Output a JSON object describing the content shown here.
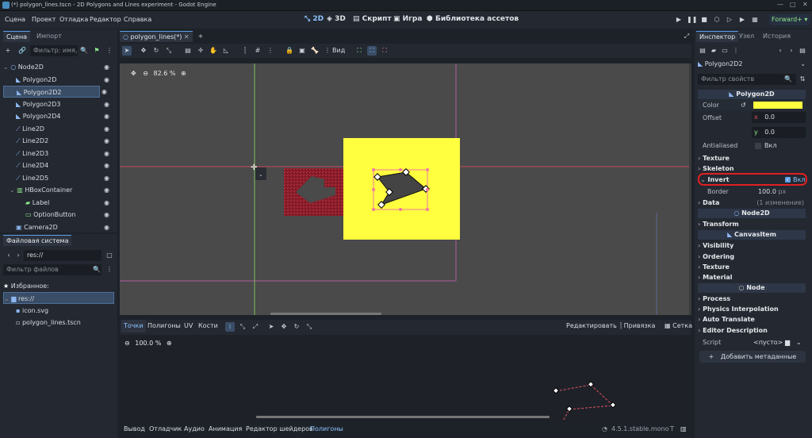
{
  "window": {
    "title": "(*) polygon_lines.tscn - 2D Polygons and Lines experiment - Godot Engine"
  },
  "menu": [
    "Сцена",
    "Проект",
    "Отладка",
    "Редактор",
    "Справка"
  ],
  "workspaces": [
    {
      "label": "2D"
    },
    {
      "label": "3D"
    },
    {
      "label": "Скрипт"
    },
    {
      "label": "Игра"
    },
    {
      "label": "Библиотека ассетов"
    }
  ],
  "renderer": "Forward+",
  "scene_panel": {
    "tabs": [
      "Сцена",
      "Импорт"
    ],
    "filter_placeholder": "Фильтр: имя, т",
    "nodes": [
      {
        "label": "Node2D",
        "icon": "node2d-icon"
      },
      {
        "label": "Polygon2D",
        "icon": "polygon-icon"
      },
      {
        "label": "Polygon2D2",
        "icon": "polygon-icon"
      },
      {
        "label": "Polygon2D3",
        "icon": "polygon-icon"
      },
      {
        "label": "Polygon2D4",
        "icon": "polygon-icon"
      },
      {
        "label": "Line2D",
        "icon": "line-icon"
      },
      {
        "label": "Line2D2",
        "icon": "line-icon"
      },
      {
        "label": "Line2D3",
        "icon": "line-icon"
      },
      {
        "label": "Line2D4",
        "icon": "line-icon"
      },
      {
        "label": "Line2D5",
        "icon": "line-icon"
      },
      {
        "label": "HBoxContainer",
        "icon": "hbox-icon"
      },
      {
        "label": "Label",
        "icon": "label-icon"
      },
      {
        "label": "OptionButton",
        "icon": "option-button-icon"
      },
      {
        "label": "Camera2D",
        "icon": "camera-icon"
      }
    ]
  },
  "filesystem": {
    "tab": "Файловая система",
    "path": "res://",
    "filter_placeholder": "Фильтр файлов",
    "favorites": "Избранное:",
    "root": "res://",
    "files": [
      "icon.svg",
      "polygon_lines.tscn"
    ]
  },
  "editor_tab": "polygon_lines(*)",
  "toolbar": {
    "view_label": "Вид"
  },
  "viewport": {
    "zoom": "82.6 %"
  },
  "polygon_editor": {
    "tabs": [
      "Точки",
      "Полигоны",
      "UV",
      "Кости"
    ],
    "edit_label": "Редактировать",
    "snap_label": "Привязка",
    "grid_label": "Сетка",
    "zoom": "100.0 %"
  },
  "bottom_bar": {
    "tabs": [
      "Вывод",
      "Отладчик",
      "Аудио",
      "Анимация",
      "Редактор шейдеров",
      "Полигоны"
    ],
    "version": "4.5.1.stable.mono"
  },
  "inspector": {
    "tabs": [
      "Инспектор",
      "Узел",
      "История"
    ],
    "node_name": "Polygon2D2",
    "filter_placeholder": "Фильтр свойств",
    "class_header": "Polygon2D",
    "color_label": "Color",
    "offset_label": "Offset",
    "offset_x": "0.0",
    "offset_y": "0.0",
    "x_label": "x",
    "y_label": "y",
    "antialiased_label": "Antialiased",
    "antialiased_value": "Вкл",
    "texture_label": "Texture",
    "skeleton_label": "Skeleton",
    "invert_label": "Invert",
    "invert_value": "Вкл",
    "border_label": "Border",
    "border_value": "100.0",
    "border_unit": "px",
    "data_label": "Data",
    "data_changes": "(1 изменение)",
    "node2d_header": "Node2D",
    "transform_label": "Transform",
    "canvasitem_header": "CanvasItem",
    "visibility_label": "Visibility",
    "ordering_label": "Ordering",
    "texture2_label": "Texture",
    "material_label": "Material",
    "node_header": "Node",
    "process_label": "Process",
    "physics_label": "Physics Interpolation",
    "autotranslate_label": "Auto Translate",
    "editordesc_label": "Editor Description",
    "script_label": "Script",
    "script_value": "<пусто>",
    "add_meta_label": "Добавить метаданные"
  },
  "colors": {
    "accent": "#5c9ee8",
    "yellow": "#ffff40",
    "selection": "#3a4d66",
    "invert_highlight": "#e02020"
  }
}
